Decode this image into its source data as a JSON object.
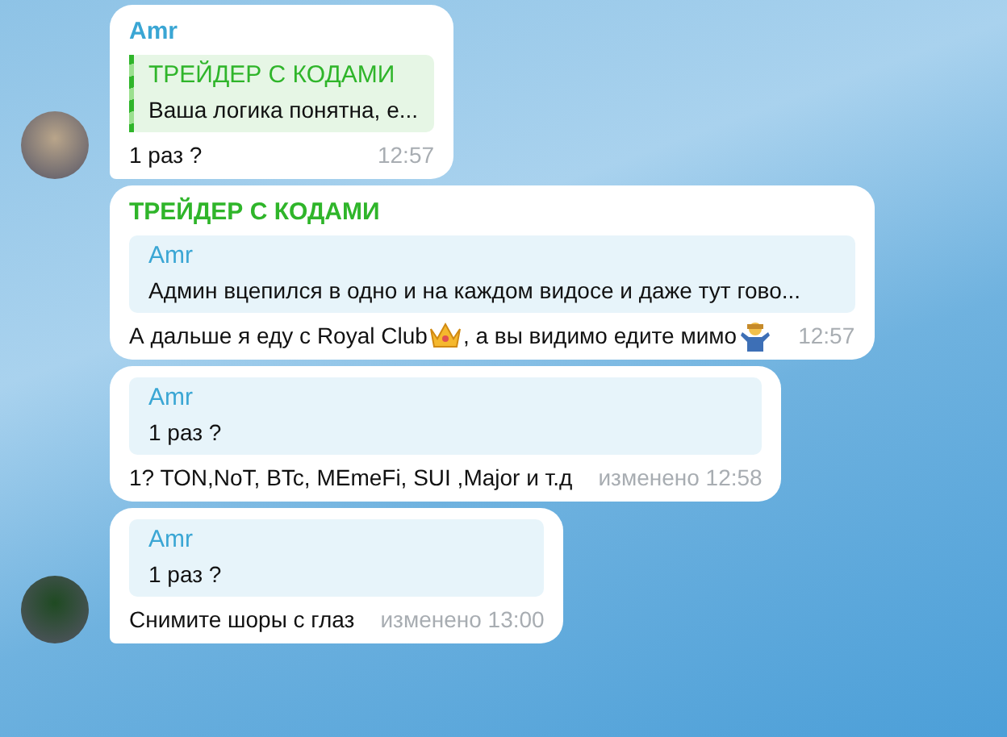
{
  "messages": [
    {
      "has_avatar": true,
      "sender": {
        "name": "Amr",
        "color": "#3aa6d4"
      },
      "reply": {
        "name": "ТРЕЙДЕР С КОДАМИ",
        "text": "Ваша логика понятна, е...",
        "color": "#2fb52a",
        "striped": true
      },
      "body": [
        "1 раз ?"
      ],
      "time": "12:57"
    },
    {
      "has_avatar": false,
      "sender": {
        "name": "ТРЕЙДЕР С КОДАМИ",
        "color": "#2fb52a"
      },
      "reply": {
        "name": "Amr",
        "text": "Админ вцепился в одно и на каждом видосе и даже тут гово...",
        "color": "#3aa6d4",
        "striped": false
      },
      "body": [
        "А дальше я еду с Royal Club",
        ", а вы видимо едите мимо"
      ],
      "time": "12:57"
    },
    {
      "has_avatar": false,
      "reply": {
        "name": "Amr",
        "text": "1 раз ?",
        "color": "#3aa6d4",
        "striped": false
      },
      "body": [
        "1? TON,NoT, BTc, MEmeFi, SUI ,Major и т.д"
      ],
      "time": "изменено 12:58"
    },
    {
      "has_avatar": true,
      "reply": {
        "name": "Amr",
        "text": "1 раз ?",
        "color": "#3aa6d4",
        "striped": false
      },
      "body": [
        "Снимите шоры с глаз"
      ],
      "time": "изменено 13:00"
    }
  ]
}
